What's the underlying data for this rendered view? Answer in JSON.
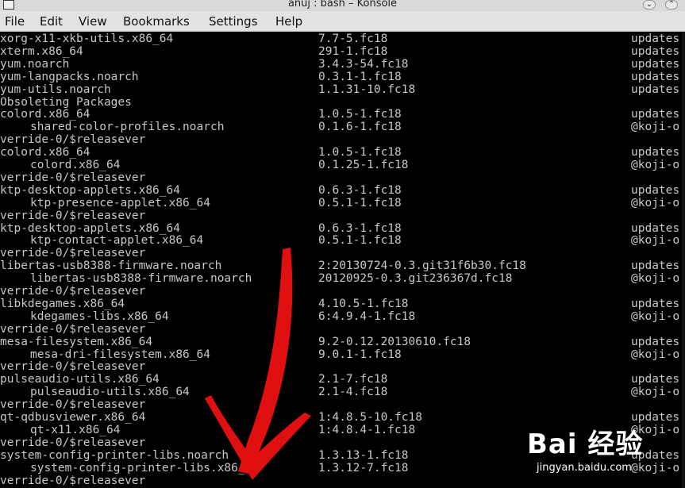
{
  "window": {
    "title": "anuj : bash – Konsole"
  },
  "menu": [
    "File",
    "Edit",
    "View",
    "Bookmarks",
    "Settings",
    "Help"
  ],
  "rows": [
    {
      "pkg": "xorg-x11-xkb-utils.x86_64",
      "indent": false,
      "ver": "7.7-5.fc18",
      "repo": "updates"
    },
    {
      "pkg": "xterm.x86_64",
      "indent": false,
      "ver": "291-1.fc18",
      "repo": "updates"
    },
    {
      "pkg": "yum.noarch",
      "indent": false,
      "ver": "3.4.3-54.fc18",
      "repo": "updates"
    },
    {
      "pkg": "yum-langpacks.noarch",
      "indent": false,
      "ver": "0.3.1-1.fc18",
      "repo": "updates"
    },
    {
      "pkg": "yum-utils.noarch",
      "indent": false,
      "ver": "1.1.31-10.fc18",
      "repo": "updates"
    },
    {
      "pkg": "Obsoleting Packages",
      "indent": false,
      "ver": "",
      "repo": ""
    },
    {
      "pkg": "colord.x86_64",
      "indent": false,
      "ver": "1.0.5-1.fc18",
      "repo": "updates"
    },
    {
      "pkg": "shared-color-profiles.noarch",
      "indent": true,
      "ver": "0.1.6-1.fc18",
      "repo": "@koji-o"
    },
    {
      "pkg": "verride-0/$releasever",
      "indent": false,
      "ver": "",
      "repo": ""
    },
    {
      "pkg": "colord.x86_64",
      "indent": false,
      "ver": "1.0.5-1.fc18",
      "repo": "updates"
    },
    {
      "pkg": "colord.x86_64",
      "indent": true,
      "ver": "0.1.25-1.fc18",
      "repo": "@koji-o"
    },
    {
      "pkg": "verride-0/$releasever",
      "indent": false,
      "ver": "",
      "repo": ""
    },
    {
      "pkg": "ktp-desktop-applets.x86_64",
      "indent": false,
      "ver": "0.6.3-1.fc18",
      "repo": "updates"
    },
    {
      "pkg": "ktp-presence-applet.x86_64",
      "indent": true,
      "ver": "0.5.1-1.fc18",
      "repo": "@koji-o"
    },
    {
      "pkg": "verride-0/$releasever",
      "indent": false,
      "ver": "",
      "repo": ""
    },
    {
      "pkg": "ktp-desktop-applets.x86_64",
      "indent": false,
      "ver": "0.6.3-1.fc18",
      "repo": "updates"
    },
    {
      "pkg": "ktp-contact-applet.x86_64",
      "indent": true,
      "ver": "0.5.1-1.fc18",
      "repo": "@koji-o"
    },
    {
      "pkg": "verride-0/$releasever",
      "indent": false,
      "ver": "",
      "repo": ""
    },
    {
      "pkg": "libertas-usb8388-firmware.noarch",
      "indent": false,
      "ver": "2:20130724-0.3.git31f6b30.fc18",
      "repo": "updates"
    },
    {
      "pkg": "libertas-usb8388-firmware.noarch",
      "indent": true,
      "ver": "20120925-0.3.git236367d.fc18",
      "repo": "@koji-o"
    },
    {
      "pkg": "verride-0/$releasever",
      "indent": false,
      "ver": "",
      "repo": ""
    },
    {
      "pkg": "libkdegames.x86_64",
      "indent": false,
      "ver": "4.10.5-1.fc18",
      "repo": "updates"
    },
    {
      "pkg": "kdegames-libs.x86_64",
      "indent": true,
      "ver": "6:4.9.4-1.fc18",
      "repo": "@koji-o"
    },
    {
      "pkg": "verride-0/$releasever",
      "indent": false,
      "ver": "",
      "repo": ""
    },
    {
      "pkg": "mesa-filesystem.x86_64",
      "indent": false,
      "ver": "9.2-0.12.20130610.fc18",
      "repo": "updates"
    },
    {
      "pkg": "mesa-dri-filesystem.x86_64",
      "indent": true,
      "ver": "9.0.1-1.fc18",
      "repo": "@koji-o"
    },
    {
      "pkg": "verride-0/$releasever",
      "indent": false,
      "ver": "",
      "repo": ""
    },
    {
      "pkg": "pulseaudio-utils.x86_64",
      "indent": false,
      "ver": "2.1-7.fc18",
      "repo": "updates"
    },
    {
      "pkg": "pulseaudio-utils.x86_64",
      "indent": true,
      "ver": "2.1-4.fc18",
      "repo": "@koji-o"
    },
    {
      "pkg": "verride-0/$releasever",
      "indent": false,
      "ver": "",
      "repo": ""
    },
    {
      "pkg": "qt-qdbusviewer.x86_64",
      "indent": false,
      "ver": "1:4.8.5-10.fc18",
      "repo": "updates"
    },
    {
      "pkg": "qt-x11.x86_64",
      "indent": true,
      "ver": "1:4.8.4-1.fc18",
      "repo": "@koji-o"
    },
    {
      "pkg": "verride-0/$releasever",
      "indent": false,
      "ver": "",
      "repo": ""
    },
    {
      "pkg": "system-config-printer-libs.noarch",
      "indent": false,
      "ver": "1.3.13-1.fc18",
      "repo": "updates"
    },
    {
      "pkg": "system-config-printer-libs.x86_64",
      "indent": true,
      "ver": "1.3.12-7.fc18",
      "repo": "@koji-o"
    },
    {
      "pkg": "verride-0/$releasever",
      "indent": false,
      "ver": "",
      "repo": ""
    }
  ],
  "annotation": {
    "type": "arrow",
    "color": "#e01010"
  },
  "watermark": {
    "logo": "Bai 经验",
    "url": "jingyan.baidu.com"
  }
}
